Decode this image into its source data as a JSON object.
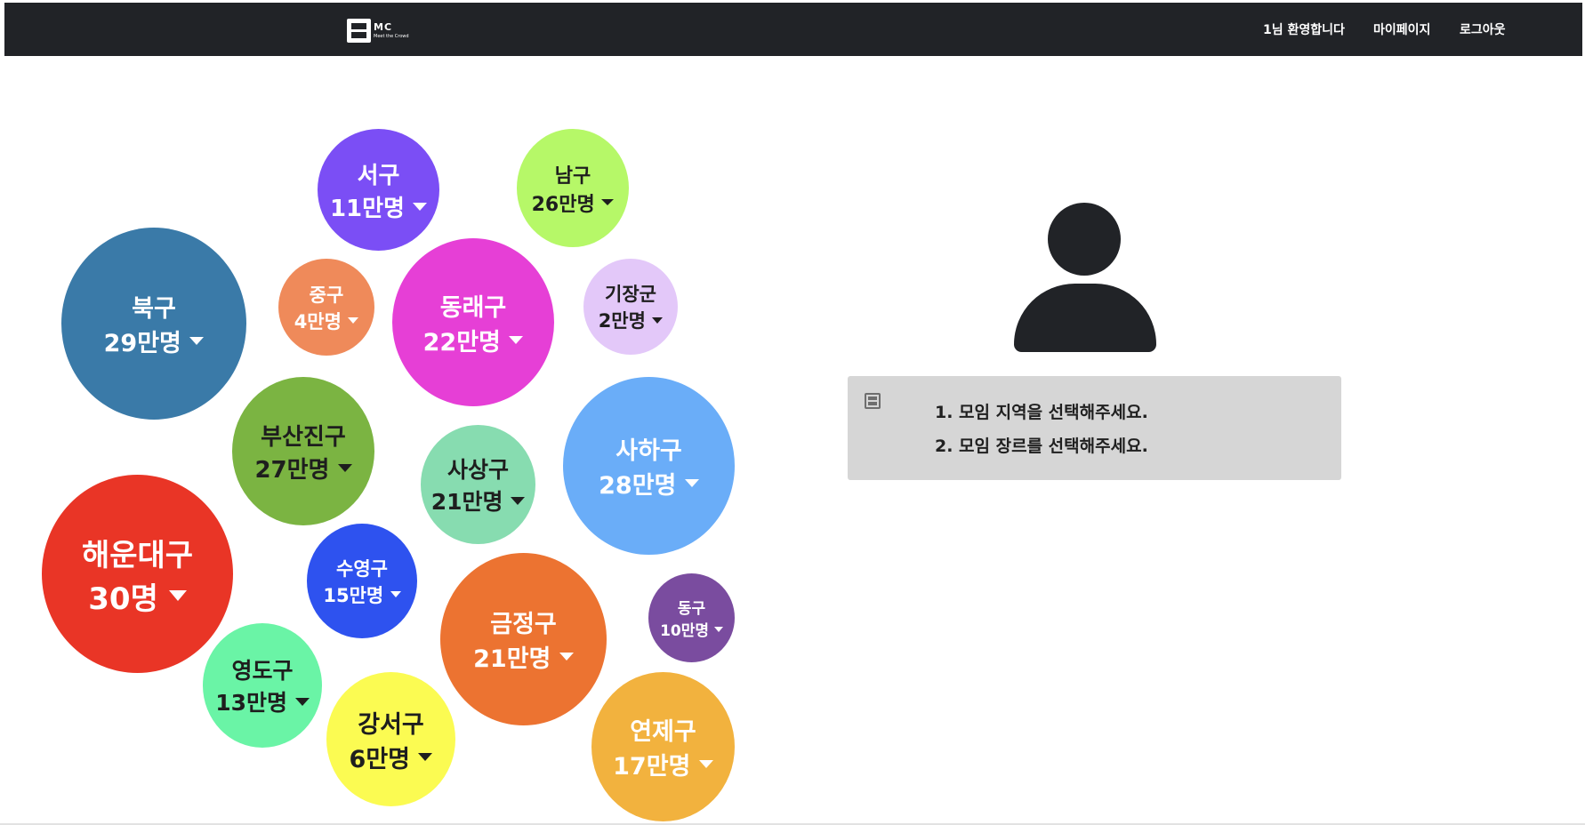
{
  "header": {
    "logo_text": "MC",
    "logo_subtext": "Meet the Crowd",
    "welcome_label": "1님 환영합니다",
    "mypage_label": "마이페이지",
    "logout_label": "로그아웃"
  },
  "districts": [
    {
      "name": "서구",
      "count": "11만명",
      "color": "#7b4ef5"
    },
    {
      "name": "남구",
      "count": "26만명",
      "color": "#b6f868"
    },
    {
      "name": "북구",
      "count": "29만명",
      "color": "#3a7aa8"
    },
    {
      "name": "중구",
      "count": "4만명",
      "color": "#ef8a5a"
    },
    {
      "name": "동래구",
      "count": "22만명",
      "color": "#e63fd6"
    },
    {
      "name": "기장군",
      "count": "2만명",
      "color": "#e3c8f9"
    },
    {
      "name": "부산진구",
      "count": "27만명",
      "color": "#7bb442"
    },
    {
      "name": "사상구",
      "count": "21만명",
      "color": "#87dcb0"
    },
    {
      "name": "사하구",
      "count": "28만명",
      "color": "#6aadf8"
    },
    {
      "name": "해운대구",
      "count": "30명",
      "color": "#e93526"
    },
    {
      "name": "수영구",
      "count": "15만명",
      "color": "#2e52ef"
    },
    {
      "name": "금정구",
      "count": "21만명",
      "color": "#ec7331"
    },
    {
      "name": "동구",
      "count": "10만명",
      "color": "#7a4c9f"
    },
    {
      "name": "영도구",
      "count": "13만명",
      "color": "#6af4a6"
    },
    {
      "name": "강서구",
      "count": "6만명",
      "color": "#fbfb52"
    },
    {
      "name": "연제구",
      "count": "17만명",
      "color": "#f2b23e"
    }
  ],
  "instructions": {
    "line1": "1. 모임 지역을 선택해주세요.",
    "line2": "2. 모임 장르를 선택해주세요."
  }
}
